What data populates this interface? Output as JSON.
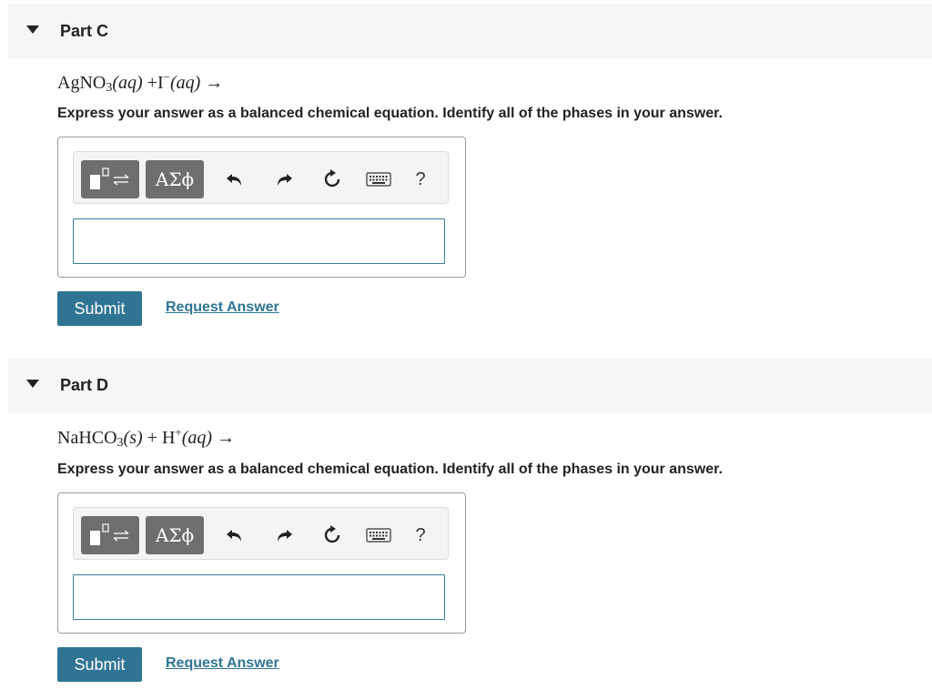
{
  "parts": [
    {
      "title": "Part C",
      "equation": {
        "reactant1": "AgNO",
        "reactant1_sub": "3",
        "reactant1_phase": "(aq)",
        "plus": "+",
        "reactant2": "I",
        "reactant2_charge": "−",
        "reactant2_phase": "(aq)",
        "arrow": "→"
      },
      "instruction": "Express your answer as a balanced chemical equation. Identify all of the phases in your answer.",
      "toolbar": {
        "greek_label": "ΑΣϕ",
        "help_label": "?"
      },
      "answer_value": "",
      "submit_label": "Submit",
      "request_label": "Request Answer"
    },
    {
      "title": "Part D",
      "equation": {
        "reactant1": "NaHCO",
        "reactant1_sub": "3",
        "reactant1_phase": "(s)",
        "plus": "+",
        "reactant2": "H",
        "reactant2_charge": "+",
        "reactant2_phase": "(aq)",
        "arrow": "→"
      },
      "instruction": "Express your answer as a balanced chemical equation. Identify all of the phases in your answer.",
      "toolbar": {
        "greek_label": "ΑΣϕ",
        "help_label": "?"
      },
      "answer_value": "",
      "submit_label": "Submit",
      "request_label": "Request Answer"
    }
  ],
  "icons": {
    "collapse": "chevron-down-icon",
    "template": "template-icon",
    "undo": "undo-icon",
    "redo": "redo-icon",
    "reset": "reset-icon",
    "keyboard": "keyboard-icon",
    "help": "help-icon"
  },
  "colors": {
    "accent": "#2f7593",
    "header_bg": "#f6f6f6",
    "toolbar_dark": "#6e6e6e"
  }
}
